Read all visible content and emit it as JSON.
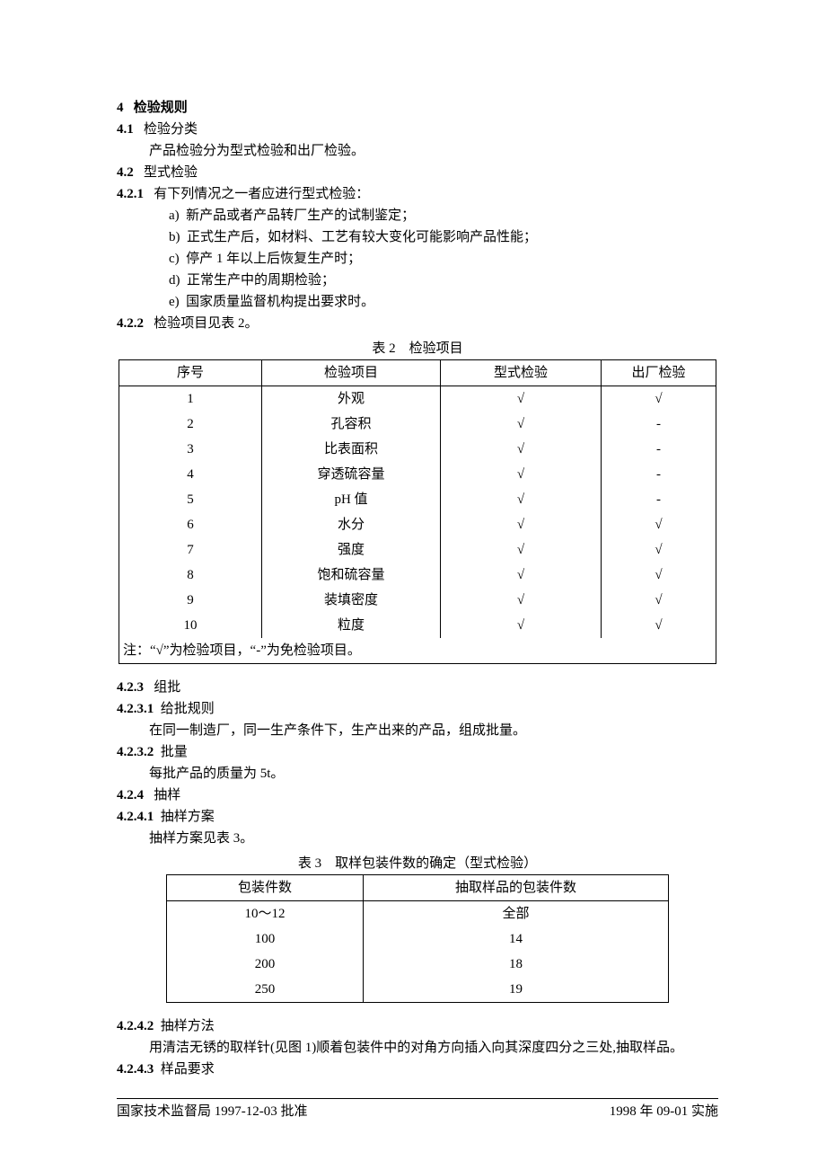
{
  "sec4": {
    "num": "4",
    "title": "检验规则"
  },
  "sec4_1": {
    "num": "4.1",
    "title": "检验分类",
    "body": "产品检验分为型式检验和出厂检验。"
  },
  "sec4_2": {
    "num": "4.2",
    "title": "型式检验"
  },
  "sec4_2_1": {
    "num": "4.2.1",
    "lead": "有下列情况之一者应进行型式检验："
  },
  "list4_2_1": {
    "a": {
      "mark": "a)",
      "text": "新产品或者产品转厂生产的试制鉴定；"
    },
    "b": {
      "mark": "b)",
      "text": "正式生产后，如材料、工艺有较大变化可能影响产品性能；"
    },
    "c": {
      "mark": "c)",
      "text": "停产 1 年以上后恢复生产时；"
    },
    "d": {
      "mark": "d)",
      "text": "正常生产中的周期检验；"
    },
    "e": {
      "mark": "e)",
      "text": "国家质量监督机构提出要求时。"
    }
  },
  "sec4_2_2": {
    "num": "4.2.2",
    "body": "检验项目见表 2。"
  },
  "table2": {
    "caption": "表 2　检验项目",
    "head": {
      "c1": "序号",
      "c2": "检验项目",
      "c3": "型式检验",
      "c4": "出厂检验"
    },
    "rows": [
      {
        "c1": "1",
        "c2": "外观",
        "c3": "√",
        "c4": "√"
      },
      {
        "c1": "2",
        "c2": "孔容积",
        "c3": "√",
        "c4": "-"
      },
      {
        "c1": "3",
        "c2": "比表面积",
        "c3": "√",
        "c4": "-"
      },
      {
        "c1": "4",
        "c2": "穿透硫容量",
        "c3": "√",
        "c4": "-"
      },
      {
        "c1": "5",
        "c2": "pH 值",
        "c3": "√",
        "c4": "-"
      },
      {
        "c1": "6",
        "c2": "水分",
        "c3": "√",
        "c4": "√"
      },
      {
        "c1": "7",
        "c2": "强度",
        "c3": "√",
        "c4": "√"
      },
      {
        "c1": "8",
        "c2": "饱和硫容量",
        "c3": "√",
        "c4": "√"
      },
      {
        "c1": "9",
        "c2": "装填密度",
        "c3": "√",
        "c4": "√"
      },
      {
        "c1": "10",
        "c2": "粒度",
        "c3": "√",
        "c4": "√"
      }
    ],
    "note": "注：“√”为检验项目，“-”为免检验项目。"
  },
  "sec4_2_3": {
    "num": "4.2.3",
    "title": "组批"
  },
  "sec4_2_3_1": {
    "num": "4.2.3.1",
    "title": "给批规则",
    "body": "在同一制造厂，同一生产条件下，生产出来的产品，组成批量。"
  },
  "sec4_2_3_2": {
    "num": "4.2.3.2",
    "title": "批量",
    "body": "每批产品的质量为 5t。"
  },
  "sec4_2_4": {
    "num": "4.2.4",
    "title": "抽样"
  },
  "sec4_2_4_1": {
    "num": "4.2.4.1",
    "title": "抽样方案",
    "body": "抽样方案见表 3。"
  },
  "table3": {
    "caption": "表 3　取样包装件数的确定（型式检验）",
    "head": {
      "c1": "包装件数",
      "c2": "抽取样品的包装件数"
    },
    "rows": [
      {
        "c1": "10～12",
        "c2": "全部"
      },
      {
        "c1": "100",
        "c2": "14"
      },
      {
        "c1": "200",
        "c2": "18"
      },
      {
        "c1": "250",
        "c2": "19"
      }
    ]
  },
  "sec4_2_4_2": {
    "num": "4.2.4.2",
    "title": "抽样方法",
    "body": "用清洁无锈的取样针(见图 1)顺着包装件中的对角方向插入向其深度四分之三处,抽取样品。"
  },
  "sec4_2_4_3": {
    "num": "4.2.4.3",
    "title": "样品要求"
  },
  "footer": {
    "left": "国家技术监督局 1997-12-03 批准",
    "right": "1998 年 09-01 实施"
  }
}
